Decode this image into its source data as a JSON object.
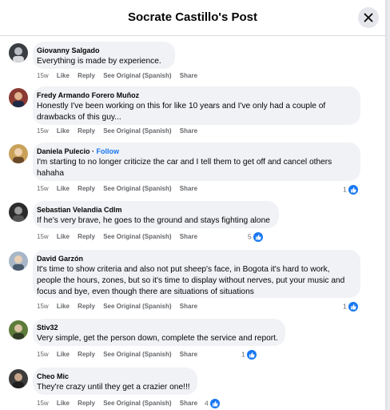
{
  "header": {
    "title": "Socrate Castillo's Post"
  },
  "colors": {
    "accent": "#1877f2",
    "bubble": "#f0f2f5",
    "meta_text": "#65676b"
  },
  "icons": {
    "close": "close-icon",
    "reaction": "like-icon"
  },
  "comment_actions": {
    "like": "Like",
    "reply": "Reply",
    "see_original": "See Original (Spanish)",
    "share": "Share"
  },
  "comments": [
    {
      "name": "Giovanny Salgado",
      "lines": [
        "Everything is made by experience."
      ],
      "time": "15w",
      "reactions": ""
    },
    {
      "name": "Fredy Armando Forero Muñoz",
      "lines": [
        "Honestly I've been working on this for like 10 years and I've only had a couple of",
        "drawbacks of this guy..."
      ],
      "time": "15w",
      "reactions": ""
    },
    {
      "name": "Daniela Pulecio",
      "follow": "Follow",
      "lines": [
        "I'm starting to no longer criticize the car and I tell them to get off and cancel others",
        "hahaha"
      ],
      "time": "15w",
      "reactions": "1"
    },
    {
      "name": "Sebastian Velandia Cdlm",
      "lines": [
        "If he's very brave, he goes to the ground and stays fighting alone"
      ],
      "time": "15w",
      "reactions": "5"
    },
    {
      "name": "David Garzón",
      "lines": [
        "It's time to show criteria and also not put sheep's face, in Bogota it's hard to work,",
        "people the hours, zones, but so it's time to display without nerves, put your music and",
        "focus and bye, even though there are situations of situations"
      ],
      "time": "15w",
      "reactions": "1"
    },
    {
      "name": "Stiv32",
      "lines": [
        "Very simple, get the person down, complete the service and report."
      ],
      "time": "15w",
      "reactions": "1"
    },
    {
      "name": "Cheo Mic",
      "lines": [
        "They're crazy until they get a crazier one!!!"
      ],
      "time": "15w",
      "reactions": "4"
    }
  ]
}
